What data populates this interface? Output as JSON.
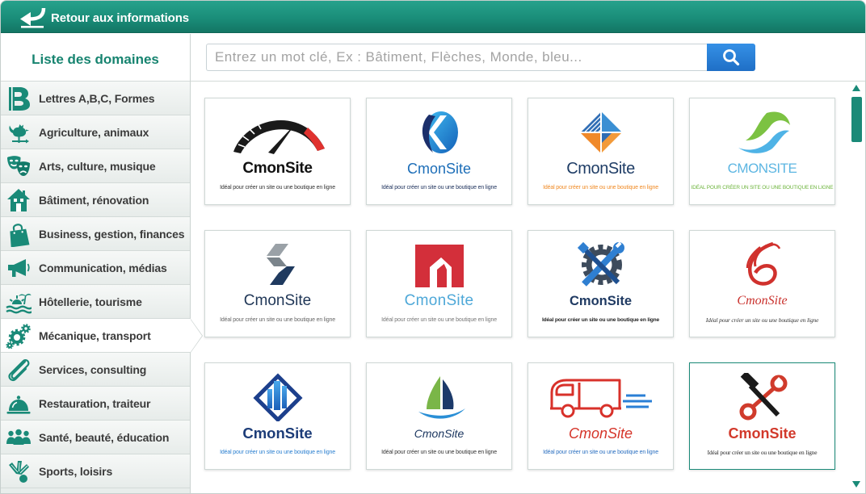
{
  "header": {
    "back_label": "Retour aux informations",
    "back_icon": "back-arrow-icon"
  },
  "sidebar": {
    "title": "Liste des domaines",
    "items": [
      {
        "label": "Lettres A,B,C, Formes",
        "icon": "letter-b-icon",
        "selected": false
      },
      {
        "label": "Agriculture, animaux",
        "icon": "rooster-icon",
        "selected": false
      },
      {
        "label": "Arts, culture, musique",
        "icon": "theater-masks-icon",
        "selected": false
      },
      {
        "label": "Bâtiment, rénovation",
        "icon": "house-icon",
        "selected": false
      },
      {
        "label": "Business, gestion, finances",
        "icon": "shopping-bag-icon",
        "selected": false
      },
      {
        "label": "Communication, médias",
        "icon": "megaphone-icon",
        "selected": false
      },
      {
        "label": "Hôtellerie, tourisme",
        "icon": "beach-icon",
        "selected": false
      },
      {
        "label": "Mécanique, transport",
        "icon": "gears-icon",
        "selected": true
      },
      {
        "label": "Services, consulting",
        "icon": "paperclip-icon",
        "selected": false
      },
      {
        "label": "Restauration, traiteur",
        "icon": "cloche-icon",
        "selected": false
      },
      {
        "label": "Santé, beauté, éducation",
        "icon": "people-icon",
        "selected": false
      },
      {
        "label": "Sports, loisirs",
        "icon": "shuttlecock-icon",
        "selected": false
      }
    ]
  },
  "search": {
    "placeholder": "Entrez un mot clé, Ex : Bâtiment, Flèches, Monde, bleu...",
    "value": "",
    "button_icon": "search-icon"
  },
  "logos": [
    {
      "name": "CmonSite",
      "tagline": "Idéal pour créer un site ou une boutique en ligne",
      "icon": "speedometer-logo"
    },
    {
      "name": "CmonSite",
      "tagline": "Idéal pour créer un site ou une boutique en ligne",
      "icon": "blue-circle-logo"
    },
    {
      "name": "CmonSite",
      "tagline": "Idéal pour créer un site ou une boutique en ligne",
      "icon": "diamond-logo"
    },
    {
      "name": "CMONSITE",
      "tagline": "IDÉAL POUR CRÉER UN SITE OU UNE BOUTIQUE EN LIGNE",
      "icon": "wave-s-logo"
    },
    {
      "name": "CmonSite",
      "tagline": "Idéal pour créer un site ou une boutique en ligne",
      "icon": "chevron-logo"
    },
    {
      "name": "CmonSite",
      "tagline": "Idéal pour créer un site ou une boutique en ligne",
      "icon": "red-square-logo"
    },
    {
      "name": "CmonSite",
      "tagline": "Idéal pour créer un site ou une boutique en ligne",
      "icon": "gear-wrench-logo"
    },
    {
      "name": "CmonSite",
      "tagline": "Idéal pour créer un site ou une boutique en ligne",
      "icon": "red-swirl-logo"
    },
    {
      "name": "CmonSite",
      "tagline": "Idéal pour créer un site ou une boutique en ligne",
      "icon": "building-diamond-logo"
    },
    {
      "name": "CmonSite",
      "tagline": "Idéal pour créer un site ou une boutique en ligne",
      "icon": "sailboat-logo"
    },
    {
      "name": "CmonSite",
      "tagline": "Idéal pour créer un site ou une boutique en ligne",
      "icon": "truck-logo"
    },
    {
      "name": "CmonSite",
      "tagline": "Idéal pour créer un site ou une boutique en ligne",
      "icon": "hammer-wrench-logo"
    }
  ],
  "colors": {
    "accent": "#1a8a78",
    "search_button": "#2a80d6",
    "header": "#1a8d79"
  }
}
